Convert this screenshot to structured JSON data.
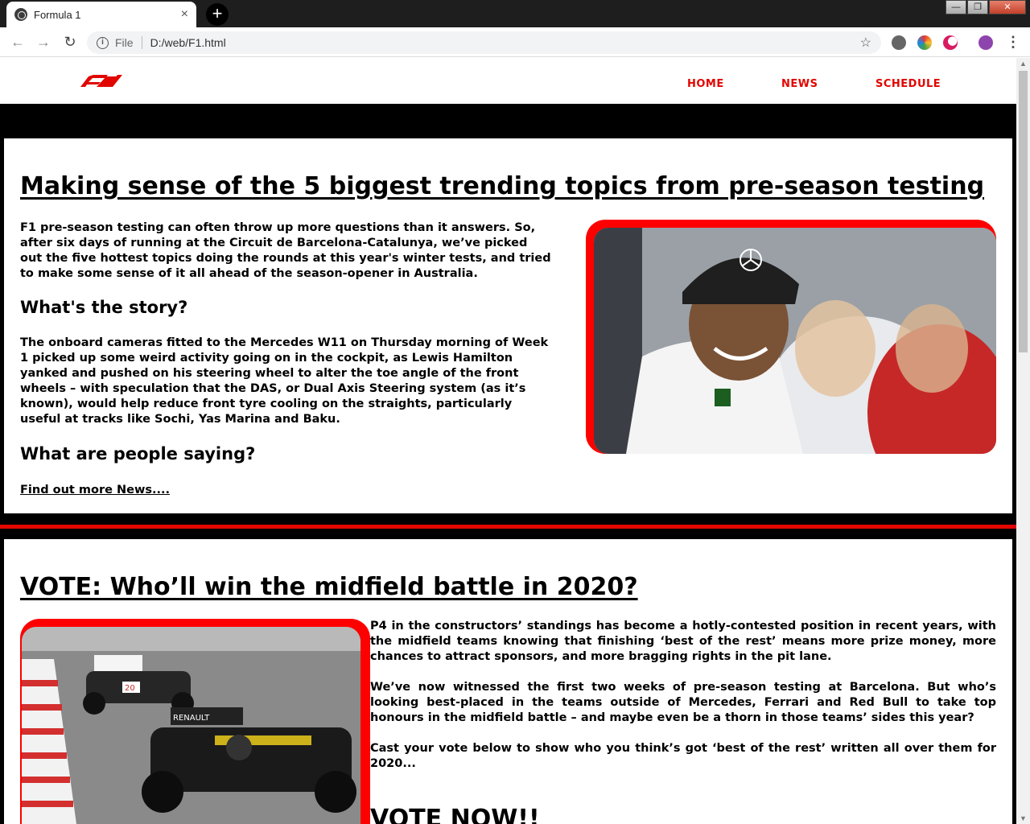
{
  "browser": {
    "tab_title": "Formula 1",
    "tab_close": "×",
    "new_tab": "+",
    "scheme_label": "File",
    "url": "D:/web/F1.html",
    "info_glyph": "i",
    "star_glyph": "☆",
    "menu_glyph": "⋮",
    "back_glyph": "←",
    "forward_glyph": "→",
    "reload_glyph": "↻",
    "win_min": "—",
    "win_max": "❐",
    "win_close": "✕"
  },
  "site": {
    "brand_color": "#e10600",
    "nav": {
      "home": "HOME",
      "news": "NEWS",
      "schedule": "SCHEDULE"
    }
  },
  "article1": {
    "headline": "Making sense of the 5 biggest trending topics from pre-season testing",
    "intro": "F1 pre-season testing can often throw up more questions than it answers. So, after six days of running at the Circuit de Barcelona-Catalunya, we’ve picked out the five hottest topics doing the rounds at this year's winter tests, and tried to make some sense of it all ahead of the season-opener in Australia.",
    "subhead1": "What's the story?",
    "story": "The onboard cameras fitted to the Mercedes W11 on Thursday morning of Week 1 picked up some weird activity going on in the cockpit, as Lewis Hamilton yanked and pushed on his steering wheel to alter the toe angle of the front wheels – with speculation that the DAS, or Dual Axis Steering system (as it’s known), would help reduce front tyre cooling on the straights, particularly useful at tracks like Sochi, Yas Marina and Baku.",
    "subhead2": "What are people saying?",
    "link": "Find out more News...."
  },
  "article2": {
    "headline": "VOTE: Who’ll win the midfield battle in 2020?",
    "p1": "P4 in the constructors’ standings has become a hotly-contested position in recent years, with the midfield teams knowing that finishing ‘best of the rest’ means more prize money, more chances to attract sponsors, and more bragging rights in the pit lane.",
    "p2": "We’ve now witnessed the first two weeks of pre-season testing at Barcelona. But who’s looking best-placed in the teams outside of Mercedes, Ferrari and Red Bull to take top honours in the midfield battle – and maybe even be a thorn in those teams’ sides this year?",
    "p3": "Cast your vote below to show who you think’s got ‘best of the rest’ written all over them for 2020...",
    "vote_heading": "VOTE NOW!!",
    "car_livery_1": "RENAULT",
    "car_number_2": "20"
  }
}
